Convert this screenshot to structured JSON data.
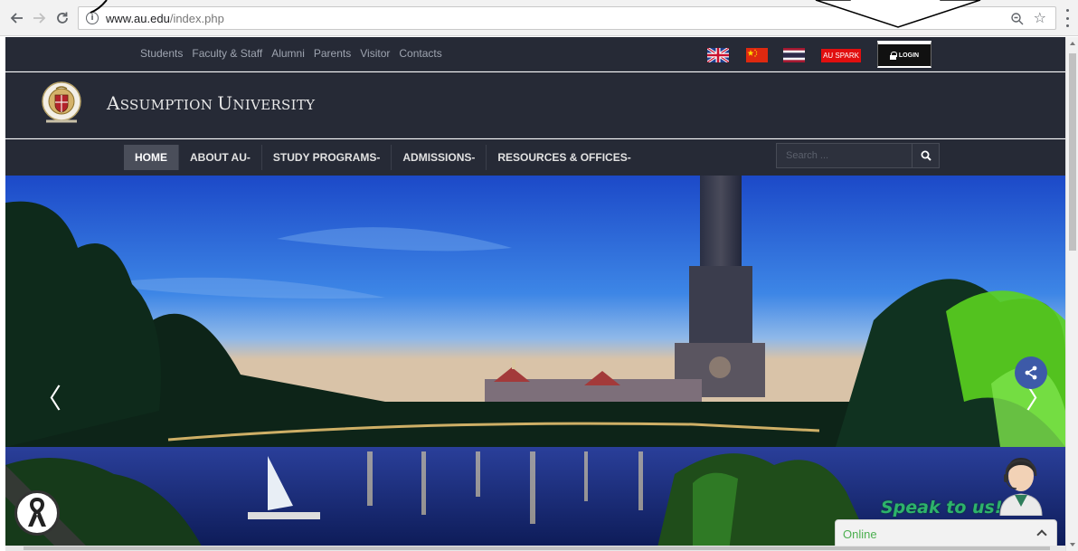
{
  "browser": {
    "url_domain": "www.au.edu",
    "url_path": "/index.php",
    "icons": {
      "back": "back-arrow-icon",
      "forward": "forward-arrow-icon",
      "reload": "reload-icon",
      "site_info": "info-icon",
      "zoom": "zoom-out-icon",
      "bookmark": "star-icon",
      "menu": "menu-dots-icon"
    },
    "info_glyph": "i",
    "star_glyph": "☆"
  },
  "topbar": {
    "links": [
      "Students",
      "Faculty & Staff",
      "Alumni",
      "Parents",
      "Visitor",
      "Contacts"
    ],
    "au_spark": "AU SPARK",
    "login": "LOGIN"
  },
  "brand": {
    "first_A": "A",
    "rest1": "SSUMPTION ",
    "first_U": "U",
    "rest2": "NIVERSITY"
  },
  "nav": {
    "home": "HOME",
    "about": "ABOUT AU",
    "programs": "STUDY PROGRAMS",
    "admissions": "ADMISSIONS",
    "resources": "RESOURCES & OFFICES",
    "dropdown_marker": "-",
    "search_placeholder": "Search ..."
  },
  "hero": {
    "prev": "〈",
    "next": "〉"
  },
  "chat": {
    "speak": "Speak to us!",
    "status": "Online"
  },
  "colors": {
    "header_bg": "#262a36",
    "active_nav": "#4a4e5a",
    "au_spark": "#e10f0f",
    "share": "#3d5aa8",
    "online": "#4caf50"
  }
}
